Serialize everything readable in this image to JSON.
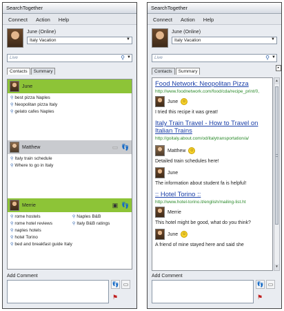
{
  "app_title": "SearchTogether",
  "menu": [
    "Connect",
    "Action",
    "Help"
  ],
  "user": {
    "status": "June (Online)",
    "session": "Italy Vacation"
  },
  "search_placeholder": "Live",
  "tabs": [
    "Contacts",
    "Summary"
  ],
  "left": {
    "contacts": [
      {
        "name": "June",
        "queries": [
          "best pizza Naples",
          "Neopolitan pizza Italy",
          "gelato cafes Naples"
        ]
      },
      {
        "name": "Matthew",
        "queries": [
          "Italy train schedule",
          "Where to go in Italy"
        ]
      },
      {
        "name": "Merrie",
        "queries_col1": [
          "rome hostels",
          "rome hotel reviews",
          "naples hotels",
          "hotel Torino",
          "bed and breakfast guide Italy"
        ],
        "queries_col2": [
          "Naples B&B",
          "Italy B&B ratings"
        ]
      }
    ]
  },
  "right": {
    "items": [
      {
        "title": "Food Network: Neopolitan Pizza",
        "url": "http://www.foodnetwork.com/food/cda/recipe_print/0,",
        "user": "June",
        "comment": "I tried this recipe  it was great!"
      },
      {
        "title": "Italy Train Travel - How to Travel on Italian Trains",
        "url": "http://goitaly.about.com/od/italytransportation/a/",
        "comments": [
          {
            "user": "Matthew",
            "text": "Detailed train schedules here!"
          },
          {
            "user": "June",
            "text": "The information about student fa is helpful!"
          }
        ]
      },
      {
        "title": ":: Hotel Torino ::",
        "url": "http://www.hotel-torino.it/english/mailing-list.ht",
        "comments": [
          {
            "user": "Merrie",
            "text": "This hotel might be good, what do you think?"
          },
          {
            "user": "June",
            "text": "A friend of mine stayed here and said she"
          }
        ]
      }
    ]
  },
  "add_comment": "Add Comment",
  "colors": {
    "active_contact": "#8dc437",
    "link": "#1a3fa8",
    "url": "#2b8a2b"
  },
  "icons": [
    "search-icon",
    "dropdown-icon",
    "query-icon",
    "smiley-icon",
    "footprint-icon",
    "web-page-icon",
    "flag-icon"
  ]
}
